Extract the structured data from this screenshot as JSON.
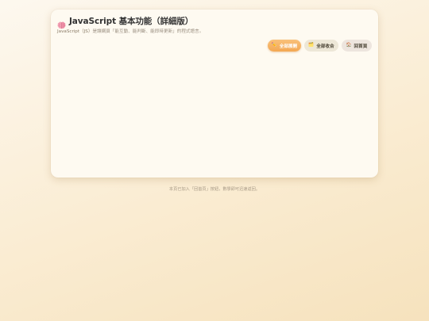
{
  "header": {
    "icon": "brain-icon",
    "title": "JavaScript 基本功能（詳細版）",
    "subtitle_prefix": "JavaScript（JS）",
    "subtitle_text": "是讓網頁「能互動、能判斷、能即時更新」的程式語言。"
  },
  "toolbar": {
    "expand_icon": "✏️",
    "expand_label": "全部展開",
    "collapse_icon": "🗂️",
    "collapse_label": "全部收合",
    "home_icon": "🏠",
    "home_label": "回首頁"
  },
  "footer": {
    "text": "本頁已加入「回首頁」按鈕，數學即可迅速返回。"
  },
  "colors": {
    "accent": "#f3a752",
    "card": "#fefaf1",
    "background": "#faecd2"
  }
}
